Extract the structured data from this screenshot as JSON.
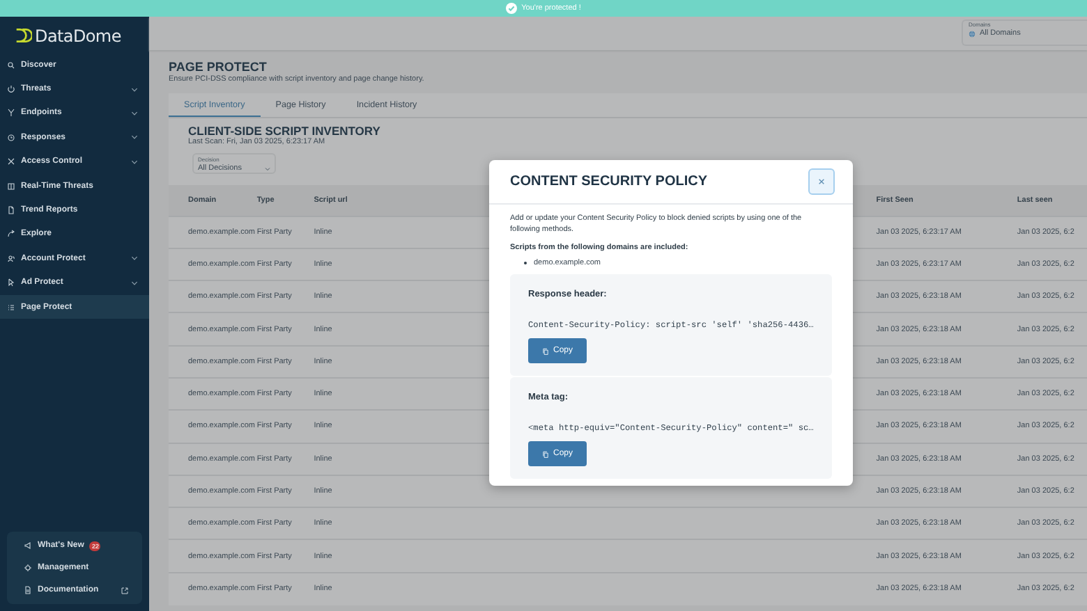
{
  "banner": {
    "text": "You're protected !"
  },
  "sidebar": {
    "logo": "DataDome",
    "items": [
      {
        "label": "Discover",
        "expandable": false,
        "selected": false
      },
      {
        "label": "Threats",
        "expandable": true,
        "selected": false
      },
      {
        "label": "Endpoints",
        "expandable": true,
        "selected": false
      },
      {
        "label": "Responses",
        "expandable": true,
        "selected": false
      },
      {
        "label": "Access Control",
        "expandable": true,
        "selected": false
      },
      {
        "label": "Real-Time Threats",
        "expandable": false,
        "selected": false
      },
      {
        "label": "Trend Reports",
        "expandable": false,
        "selected": false
      },
      {
        "label": "Explore",
        "expandable": false,
        "selected": false
      },
      {
        "label": "Account Protect",
        "expandable": true,
        "selected": false
      },
      {
        "label": "Ad Protect",
        "expandable": true,
        "selected": false
      },
      {
        "label": "Page Protect",
        "expandable": false,
        "selected": true
      }
    ],
    "footer_items": [
      {
        "label": "What's New",
        "badge": "22",
        "external": false
      },
      {
        "label": "Management",
        "external": false
      },
      {
        "label": "Documentation",
        "external": true
      }
    ]
  },
  "header": {
    "domains": {
      "label": "Domains",
      "value": "All Domains"
    }
  },
  "page": {
    "title": "PAGE PROTECT",
    "subtitle": "Ensure PCI-DSS compliance with script inventory and page change history."
  },
  "tabs": [
    {
      "label": "Script Inventory",
      "selected": true
    },
    {
      "label": "Page History",
      "selected": false
    },
    {
      "label": "Incident History",
      "selected": false
    }
  ],
  "inventory": {
    "title": "CLIENT-SIDE SCRIPT INVENTORY",
    "last_scan": "Last Scan: Fri, Jan 03 2025, 6:23:17 AM",
    "decision": {
      "label": "Decision",
      "value": "All Decisions"
    },
    "table": {
      "columns": [
        "Domain",
        "Type",
        "Script url",
        "First Seen",
        "Last seen"
      ],
      "rows": [
        [
          "demo.example.com",
          "First Party",
          "Inline",
          "Jan 03 2025, 6:23:17 AM",
          "Jan 03 2025, 6:2"
        ],
        [
          "demo.example.com",
          "First Party",
          "Inline",
          "Jan 03 2025, 6:23:17 AM",
          "Jan 03 2025, 6:2"
        ],
        [
          "demo.example.com",
          "First Party",
          "Inline",
          "Jan 03 2025, 6:23:18 AM",
          "Jan 03 2025, 6:2"
        ],
        [
          "demo.example.com",
          "First Party",
          "Inline",
          "Jan 03 2025, 6:23:18 AM",
          "Jan 03 2025, 6:2"
        ],
        [
          "demo.example.com",
          "First Party",
          "Inline",
          "Jan 03 2025, 6:23:18 AM",
          "Jan 03 2025, 6:2"
        ],
        [
          "demo.example.com",
          "First Party",
          "Inline",
          "Jan 03 2025, 6:23:18 AM",
          "Jan 03 2025, 6:2"
        ],
        [
          "demo.example.com",
          "First Party",
          "Inline",
          "Jan 03 2025, 6:23:18 AM",
          "Jan 03 2025, 6:2"
        ],
        [
          "demo.example.com",
          "First Party",
          "Inline",
          "Jan 03 2025, 6:23:18 AM",
          "Jan 03 2025, 6:2"
        ],
        [
          "demo.example.com",
          "First Party",
          "Inline",
          "Jan 03 2025, 6:23:18 AM",
          "Jan 03 2025, 6:2"
        ],
        [
          "demo.example.com",
          "First Party",
          "Inline",
          "Jan 03 2025, 6:23:18 AM",
          "Jan 03 2025, 6:2"
        ],
        [
          "demo.example.com",
          "First Party",
          "Inline",
          "Jan 03 2025, 6:23:18 AM",
          "Jan 03 2025, 6:2"
        ],
        [
          "demo.example.com",
          "First Party",
          "Inline",
          "Jan 03 2025, 6:23:18 AM",
          "Jan 03 2025, 6:2"
        ]
      ]
    }
  },
  "modal": {
    "title": "CONTENT SECURITY POLICY",
    "intro": "Add or update your Content Security Policy to block denied scripts by using one of the following methods.",
    "domains_label": "Scripts from the following domains are included:",
    "domains": [
      "demo.example.com"
    ],
    "sections": [
      {
        "title": "Response header:",
        "code": "Content-Security-Policy: script-src 'self' 'sha256-4436…",
        "button": "Copy"
      },
      {
        "title": "Meta tag:",
        "code": "<meta http-equiv=\"Content-Security-Policy\" content=\" sc…",
        "button": "Copy"
      }
    ]
  }
}
